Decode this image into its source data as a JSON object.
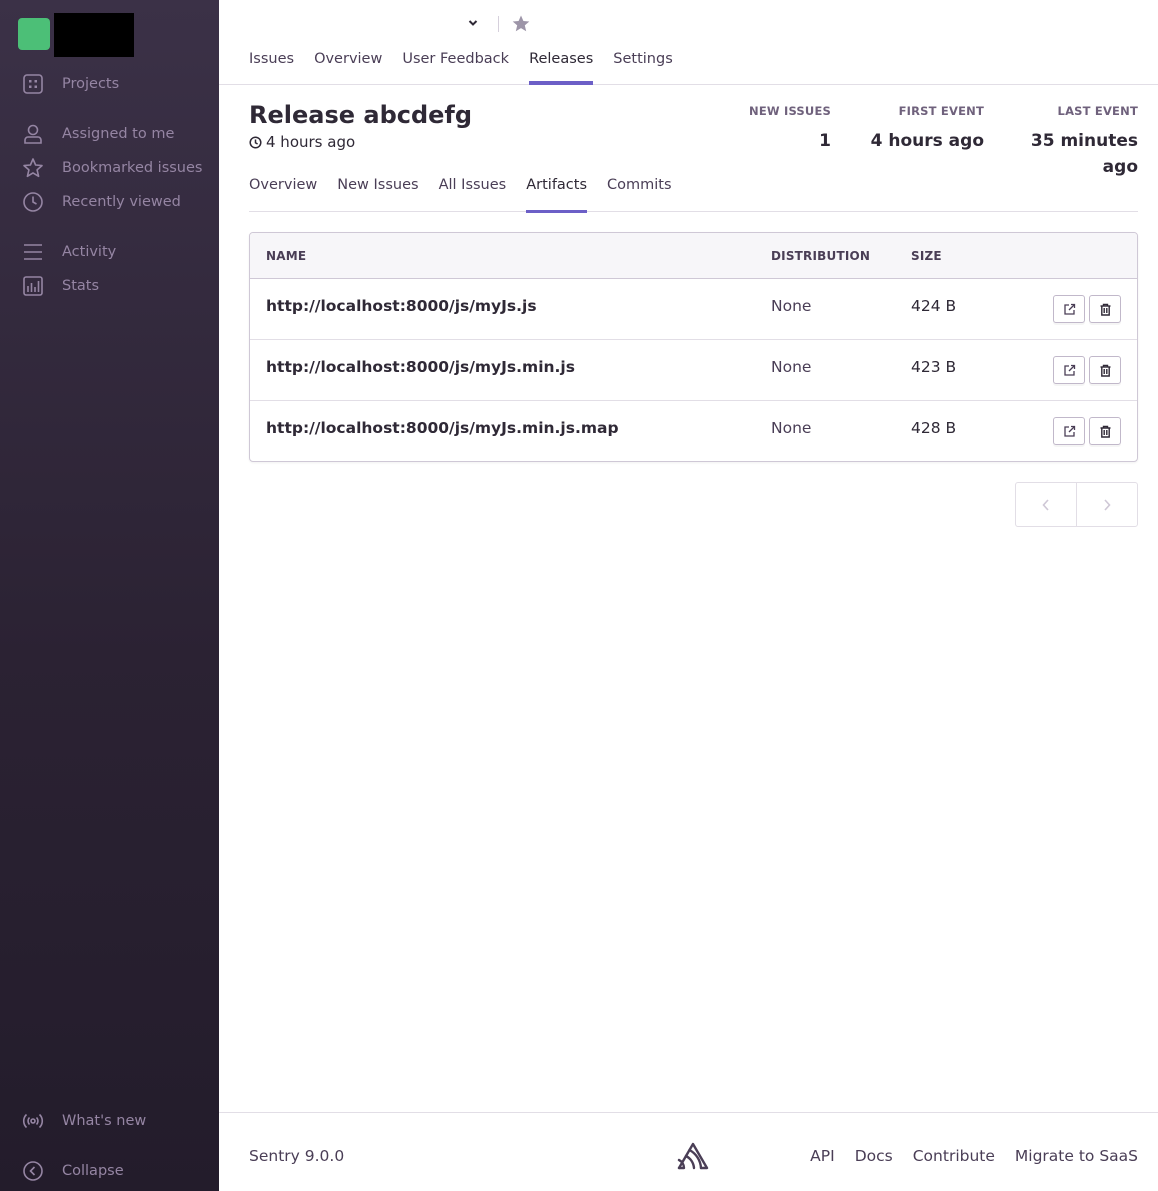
{
  "sidebar": {
    "items": [
      {
        "label": "Projects",
        "icon": "projects-icon"
      },
      {
        "label": "Assigned to me",
        "icon": "user-icon"
      },
      {
        "label": "Bookmarked issues",
        "icon": "star-icon"
      },
      {
        "label": "Recently viewed",
        "icon": "clock-icon"
      },
      {
        "label": "Activity",
        "icon": "activity-icon"
      },
      {
        "label": "Stats",
        "icon": "stats-icon"
      }
    ],
    "whats_new": "What's new",
    "collapse": "Collapse"
  },
  "top_tabs": [
    {
      "label": "Issues",
      "active": false
    },
    {
      "label": "Overview",
      "active": false
    },
    {
      "label": "User Feedback",
      "active": false
    },
    {
      "label": "Releases",
      "active": true
    },
    {
      "label": "Settings",
      "active": false
    }
  ],
  "release": {
    "title": "Release abcdefg",
    "time_ago": "4 hours ago",
    "stats": {
      "new_issues_label": "NEW ISSUES",
      "new_issues_value": "1",
      "first_event_label": "FIRST EVENT",
      "first_event_value": "4 hours ago",
      "last_event_label": "LAST EVENT",
      "last_event_value_1": "35 minutes",
      "last_event_value_2": "ago"
    }
  },
  "sub_tabs": [
    {
      "label": "Overview",
      "active": false
    },
    {
      "label": "New Issues",
      "active": false
    },
    {
      "label": "All Issues",
      "active": false
    },
    {
      "label": "Artifacts",
      "active": true
    },
    {
      "label": "Commits",
      "active": false
    }
  ],
  "artifacts": {
    "headers": {
      "name": "NAME",
      "distribution": "DISTRIBUTION",
      "size": "SIZE"
    },
    "rows": [
      {
        "name": "http://localhost:8000/js/myJs.js",
        "distribution": "None",
        "size": "424 B"
      },
      {
        "name": "http://localhost:8000/js/myJs.min.js",
        "distribution": "None",
        "size": "423 B"
      },
      {
        "name": "http://localhost:8000/js/myJs.min.js.map",
        "distribution": "None",
        "size": "428 B"
      }
    ]
  },
  "footer": {
    "version": "Sentry 9.0.0",
    "links": [
      "API",
      "Docs",
      "Contribute",
      "Migrate to SaaS"
    ]
  },
  "colors": {
    "accent": "#6c5fc7",
    "sidebar_bg": "#2f2936",
    "org_avatar": "#4cbf77"
  }
}
